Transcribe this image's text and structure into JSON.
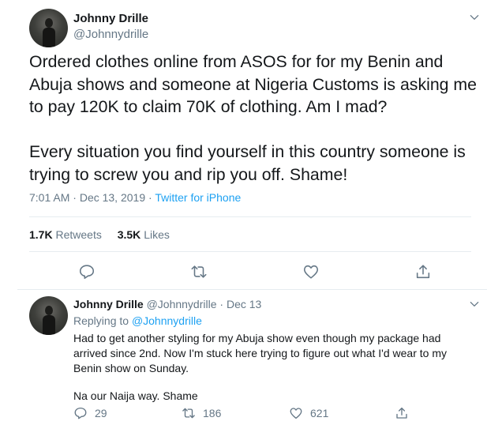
{
  "tweet": {
    "author_name": "Johnny Drille",
    "author_handle": "@Johnnydrille",
    "paragraphs": [
      "Ordered clothes online from ASOS for  for my Benin and Abuja shows and someone at Nigeria Customs is asking me to pay 120K to claim 70K of clothing. Am I mad?",
      "Every situation you find yourself in this country someone is trying to screw you and rip you off. Shame!"
    ],
    "time": "7:01 AM",
    "date": "Dec 13, 2019",
    "separator": "·",
    "source": "Twitter for iPhone",
    "retweets_count": "1.7K",
    "retweets_label": "Retweets",
    "likes_count": "3.5K",
    "likes_label": "Likes",
    "actions": [
      "reply-icon",
      "retweet-icon",
      "like-icon",
      "share-icon"
    ]
  },
  "reply": {
    "author_name": "Johnny Drille",
    "author_handle": "@Johnnydrille",
    "separator": "·",
    "date": "Dec 13",
    "replying_label": "Replying to",
    "replying_handle": "@Johnnydrille",
    "paragraphs": [
      "Had to get another styling for my Abuja show even though my package had arrived since 2nd. Now I'm stuck here trying to figure out what I'd wear to my Benin show on Sunday.",
      "Na our Naija way. Shame"
    ],
    "reply_count": "29",
    "retweet_count": "186",
    "like_count": "621"
  },
  "colors": {
    "text": "#14171a",
    "secondary": "#657786",
    "link": "#1da1f2",
    "divider": "#e6ecf0"
  }
}
